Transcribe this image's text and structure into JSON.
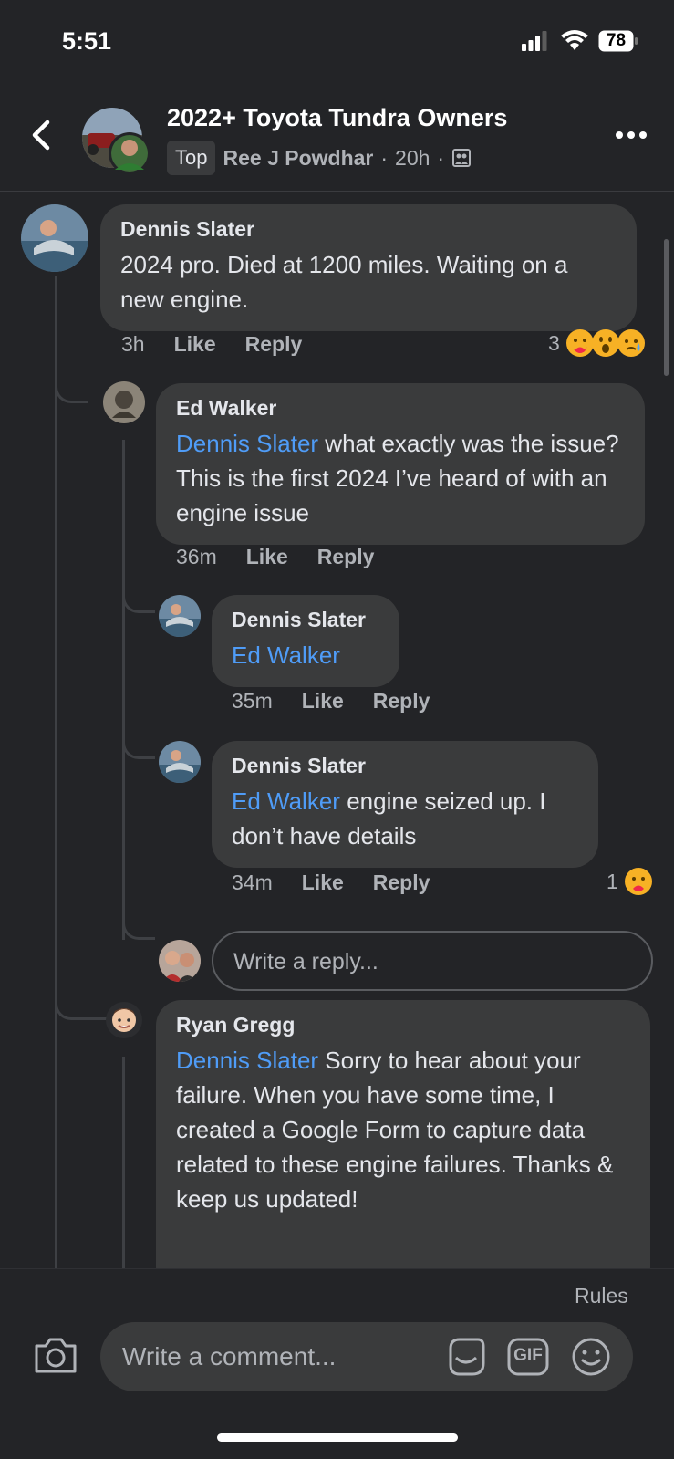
{
  "status_bar": {
    "time": "5:51",
    "battery": "78"
  },
  "header": {
    "group_title": "2022+ Toyota Tundra Owners",
    "badge": "Top",
    "author": "Ree J Powdhar",
    "separator": "·",
    "age": "20h"
  },
  "comments": [
    {
      "name": "Dennis Slater",
      "text": "2024 pro.  Died at 1200 miles.  Waiting on a new engine.",
      "time": "3h",
      "like": "Like",
      "reply": "Reply",
      "reaction_count": "3"
    },
    {
      "name": "Ed Walker",
      "mention": "Dennis Slater",
      "text": " what exactly was the issue? This is the first 2024 I’ve heard of with an engine issue",
      "time": "36m",
      "like": "Like",
      "reply": "Reply"
    },
    {
      "name": "Dennis Slater",
      "mention": "Ed Walker",
      "text": "",
      "time": "35m",
      "like": "Like",
      "reply": "Reply"
    },
    {
      "name": "Dennis Slater",
      "mention": "Ed Walker",
      "text": " engine seized up. I don’t have details",
      "time": "34m",
      "like": "Like",
      "reply": "Reply",
      "reaction_count": "1"
    },
    {
      "name": "Ryan Gregg",
      "mention": "Dennis Slater",
      "text": " Sorry to hear about your failure. When you have some time, I created a Google Form to capture data related to these engine failures. Thanks & keep us updated!"
    }
  ],
  "reply_placeholder": "Write a reply...",
  "composer": {
    "rules": "Rules",
    "placeholder": "Write a comment...",
    "gif_label": "GIF"
  },
  "colors": {
    "background": "#232427",
    "bubble": "#3a3b3c",
    "mention": "#4f9cf7",
    "muted": "#b0b3b8"
  }
}
